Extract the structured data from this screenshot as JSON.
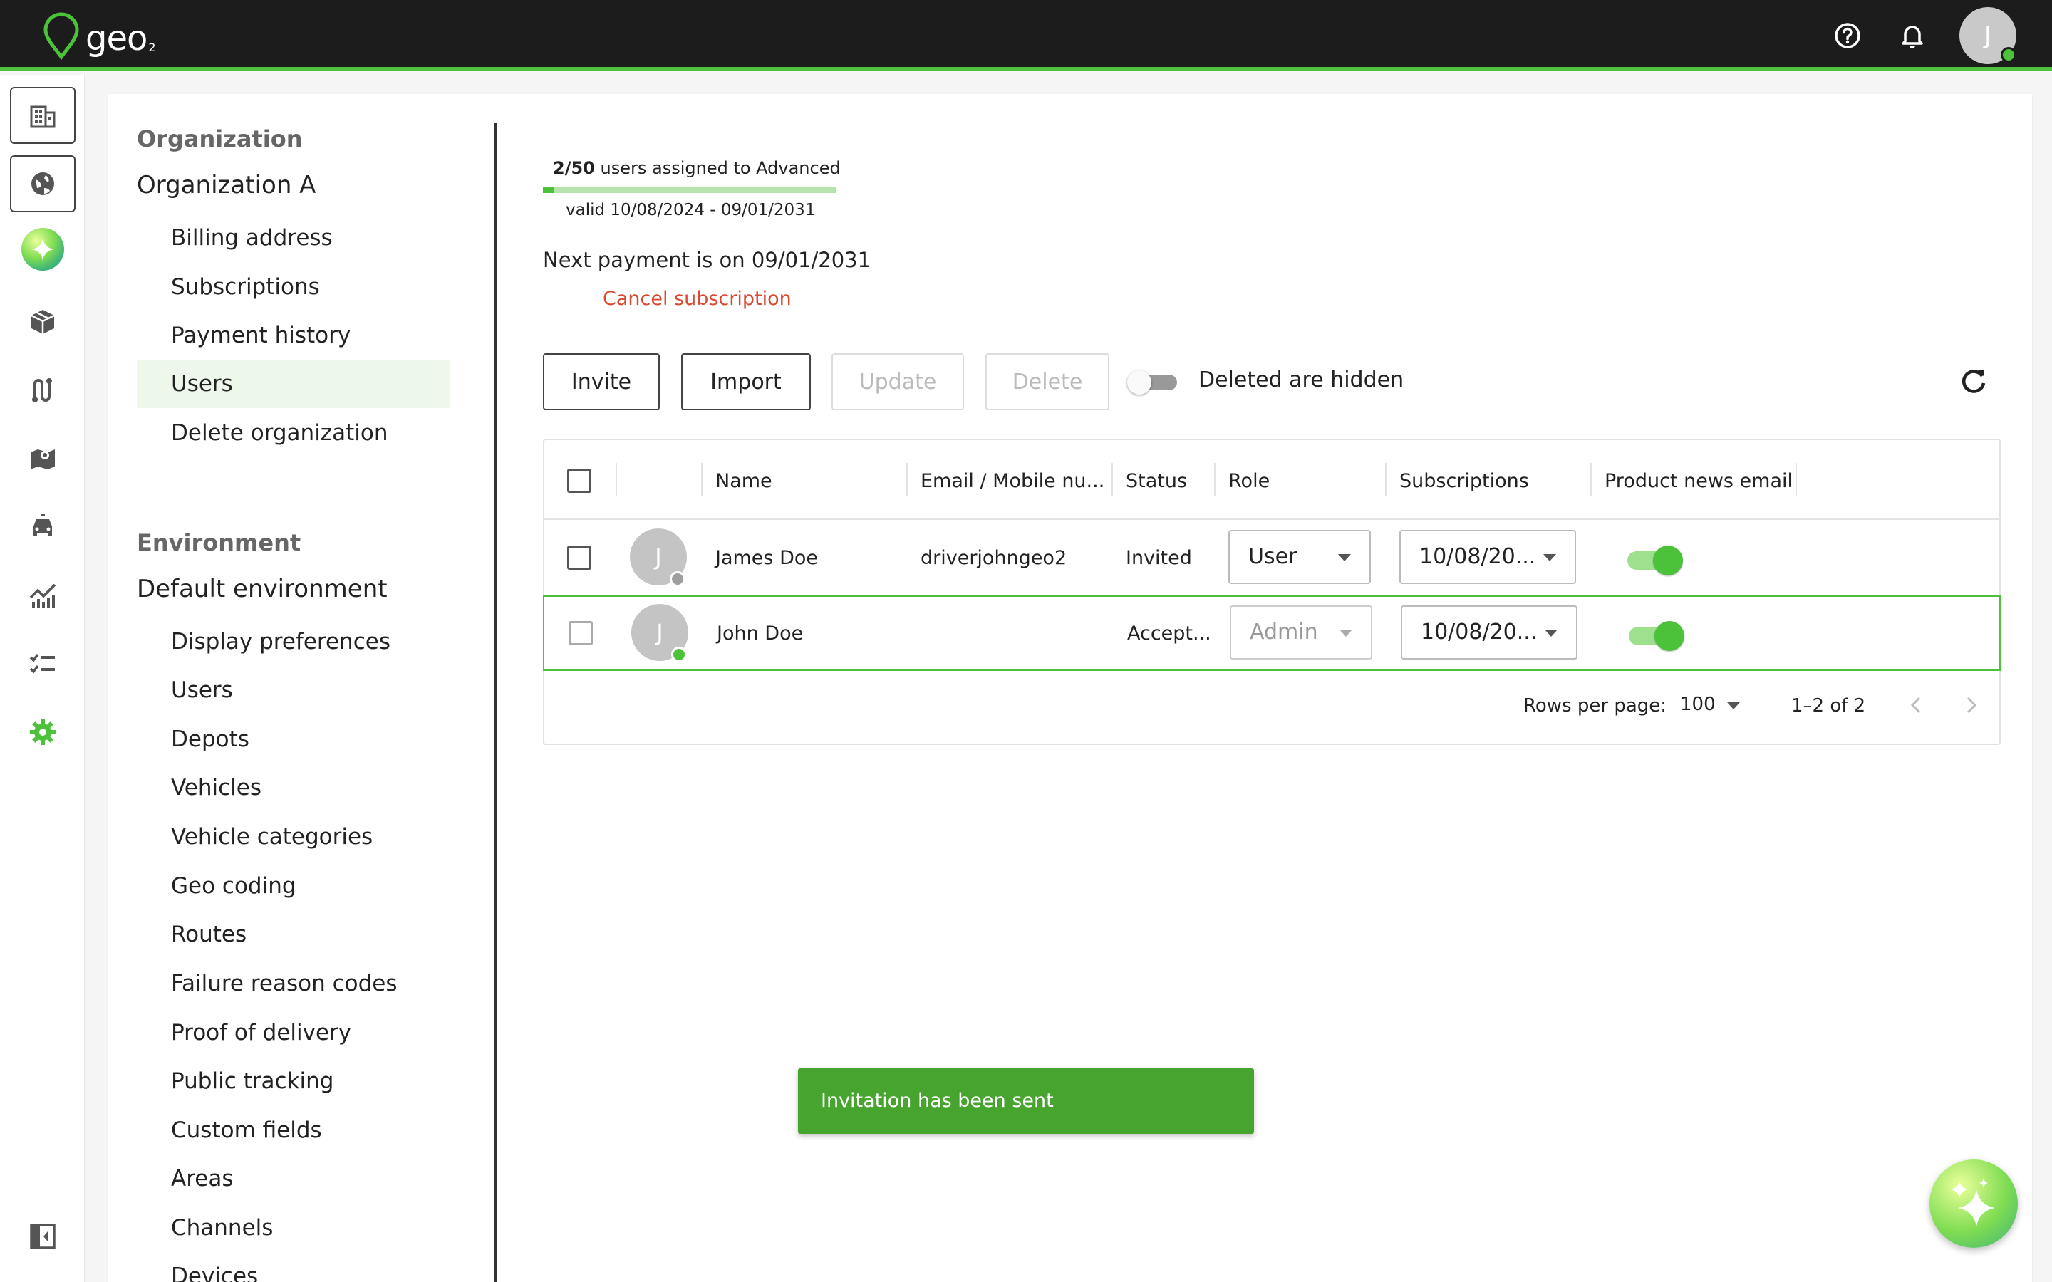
{
  "app": {
    "logo_text": "geo",
    "logo_sub": "2",
    "user_initial": "J",
    "accent_color": "#4cc23a"
  },
  "topbar": {
    "icons": [
      "help-icon",
      "bell-icon"
    ]
  },
  "rail": {
    "icons": [
      "building-icon",
      "globe-icon",
      "ai-sparkle-icon",
      "package-icon",
      "route-icon",
      "map-icon",
      "car-icon",
      "analytics-icon",
      "checklist-icon",
      "settings-icon",
      "collapse-sidebar-icon"
    ]
  },
  "sidebar": {
    "org_section": "Organization",
    "org_name": "Organization A",
    "org_items": [
      {
        "label": "Billing address"
      },
      {
        "label": "Subscriptions"
      },
      {
        "label": "Payment history"
      },
      {
        "label": "Users",
        "active": true
      },
      {
        "label": "Delete organization"
      }
    ],
    "env_section": "Environment",
    "env_name": "Default environment",
    "env_items": [
      {
        "label": "Display preferences"
      },
      {
        "label": "Users"
      },
      {
        "label": "Depots"
      },
      {
        "label": "Vehicles"
      },
      {
        "label": "Vehicle categories"
      },
      {
        "label": "Geo coding"
      },
      {
        "label": "Routes"
      },
      {
        "label": "Failure reason codes"
      },
      {
        "label": "Proof of delivery"
      },
      {
        "label": "Public tracking"
      },
      {
        "label": "Custom fields"
      },
      {
        "label": "Areas"
      },
      {
        "label": "Channels"
      },
      {
        "label": "Devices"
      }
    ]
  },
  "subscription": {
    "count": "2/50",
    "count_suffix": " users assigned to Advanced",
    "assigned": 2,
    "total": 50,
    "valid": "valid 10/08/2024 - 09/01/2031",
    "next_payment": "Next payment is on 09/01/2031",
    "cancel_label": "Cancel subscription"
  },
  "toolbar": {
    "invite": "Invite",
    "import": "Import",
    "update": "Update",
    "delete": "Delete",
    "toggle_label": "Deleted are hidden"
  },
  "table": {
    "headers": {
      "name": "Name",
      "email": "Email / Mobile nu...",
      "status": "Status",
      "role": "Role",
      "subscriptions": "Subscriptions",
      "news": "Product news email"
    },
    "rows": [
      {
        "initial": "J",
        "name": "James Doe",
        "email": "driverjohngeo2",
        "status": "Invited",
        "role": "User",
        "subscription": "10/08/20...",
        "news": true,
        "online": false
      },
      {
        "initial": "J",
        "name": "John Doe",
        "email": "",
        "status": "Accept...",
        "role": "Admin",
        "subscription": "10/08/20...",
        "news": true,
        "online": true
      }
    ],
    "footer": {
      "rows_per_page_label": "Rows per page:",
      "rows_per_page": "100",
      "range": "1–2 of 2"
    }
  },
  "snackbar": {
    "message": "Invitation has been sent"
  }
}
